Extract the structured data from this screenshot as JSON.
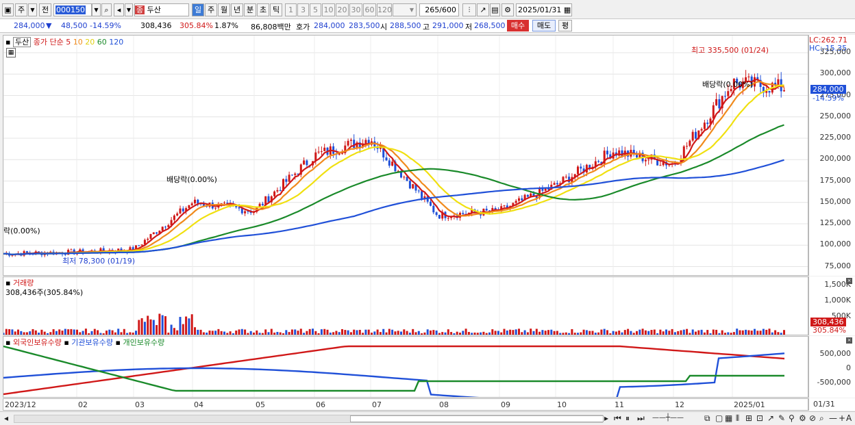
{
  "toolbar": {
    "type_label": "주",
    "prev_label": "전",
    "code": "000150",
    "name": "두산",
    "name_tag": "종",
    "periods": [
      "일",
      "주",
      "월",
      "년",
      "분",
      "초",
      "틱"
    ],
    "minutes": [
      "1",
      "3",
      "5",
      "10",
      "20",
      "30",
      "60",
      "120"
    ],
    "count": "265",
    "count_total": "/600",
    "date": "2025/01/31"
  },
  "info": {
    "price": "284,000",
    "change": "48,500",
    "change_pct": "-14.59%",
    "volume": "308,436",
    "vol_pct": "305.84%",
    "turnover": "1.87%",
    "amount": "86,808백만",
    "quote_label": "호가",
    "bid": "284,000",
    "ask": "283,500",
    "open_label": "시",
    "open": "288,500",
    "high_label": "고",
    "high": "291,000",
    "low_label": "저",
    "low": "268,500",
    "buy_label": "매수",
    "sell_label": "매도",
    "avg_label": "평"
  },
  "legend": {
    "name": "두산",
    "ma_title": "종가 단순",
    "ma_periods": [
      "5",
      "10",
      "20",
      "60",
      "120"
    ],
    "ma_colors": [
      "#d01818",
      "#f08a1c",
      "#f0e010",
      "#1a8a2a",
      "#2050d8"
    ]
  },
  "axis_info": {
    "lc": "LC:262.71",
    "hc": "HC:-15.35",
    "price_badge": "284,000",
    "price_badge_pct": "-14.59%"
  },
  "price_ticks": [
    "325,000",
    "300,000",
    "275,000",
    "250,000",
    "225,000",
    "200,000",
    "175,000",
    "150,000",
    "125,000",
    "100,000",
    "75,000"
  ],
  "annotations": {
    "high_note": "최고 335,500 (01/24)",
    "low_note": "최저 78,300 (01/19)",
    "div_note_1": "배당락(0.00%)",
    "div_note_2": "배당락(0.00%)",
    "div_note_left": "락(0.00%)"
  },
  "volume_panel": {
    "title": "거래량",
    "value": "308,436주(305.84%)",
    "ticks": [
      "1,500K",
      "1,000K",
      "500K"
    ],
    "badge": "308,436",
    "badge_pct": "305.84%"
  },
  "holdings_panel": {
    "foreign": "외국인보유수량",
    "institution": "기관보유수량",
    "individual": "개인보유수량",
    "ticks": [
      "500,000",
      "0",
      "-500,000"
    ]
  },
  "x_ticks": [
    "2023/12",
    "02",
    "03",
    "04",
    "05",
    "06",
    "07",
    "08",
    "09",
    "10",
    "11",
    "12",
    "2025/01"
  ],
  "x_end": "01/31",
  "chart_data": {
    "type": "candlestick",
    "y_range": [
      65000,
      345000
    ],
    "ma_periods": [
      5,
      10,
      20,
      60,
      120
    ],
    "close_approx": [
      {
        "x": "2023/12",
        "y": 90000
      },
      {
        "x": "02",
        "y": 92000
      },
      {
        "x": "03",
        "y": 95000
      },
      {
        "x": "04",
        "y": 150000
      },
      {
        "x": "05",
        "y": 140000
      },
      {
        "x": "06",
        "y": 205000
      },
      {
        "x": "07",
        "y": 225000
      },
      {
        "x": "08",
        "y": 135000
      },
      {
        "x": "09",
        "y": 140000
      },
      {
        "x": "10",
        "y": 170000
      },
      {
        "x": "11",
        "y": 210000
      },
      {
        "x": "12",
        "y": 195000
      },
      {
        "x": "2025/01",
        "y": 290000
      },
      {
        "x": "01/31",
        "y": 284000
      }
    ]
  }
}
